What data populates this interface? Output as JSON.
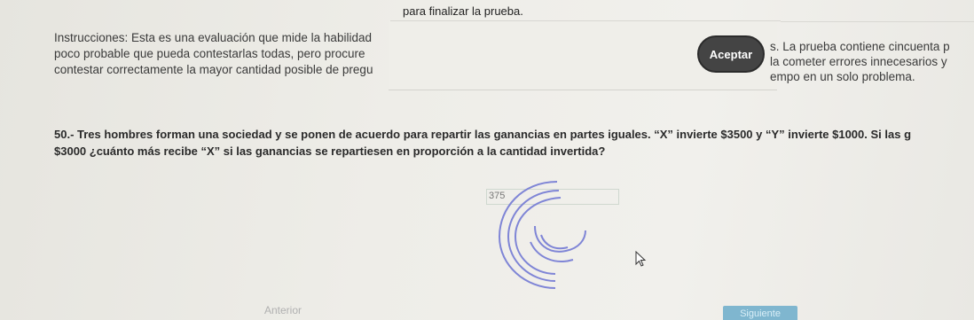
{
  "banner": {
    "text": "para finalizar la prueba."
  },
  "instructions": {
    "line1": "Instrucciones: Esta es una evaluación que mide la habilidad",
    "line2": "poco probable que pueda contestarlas todas, pero procure",
    "line3": "contestar correctamente la mayor cantidad posible de pregu",
    "right1": "s. La prueba contiene cincuenta p",
    "right2": "la cometer errores innecesarios y",
    "right3": "empo en un solo problema."
  },
  "dialog": {
    "accept_label": "Aceptar"
  },
  "question": {
    "line1": "50.- Tres hombres forman una sociedad y se ponen de acuerdo para repartir las ganancias en partes iguales. “X” invierte $3500 y “Y” invierte $1000. Si las g",
    "line2": "$3000 ¿cuánto más recibe “X” si las ganancias se repartiesen en proporción a la cantidad invertida?"
  },
  "answer": {
    "value": "375"
  },
  "nav": {
    "prev_label": "Anterior",
    "next_label": "Siguiente"
  },
  "colors": {
    "accent": "#7fb6cf",
    "button_dark": "#444444",
    "spiral": "#7f85d6"
  }
}
